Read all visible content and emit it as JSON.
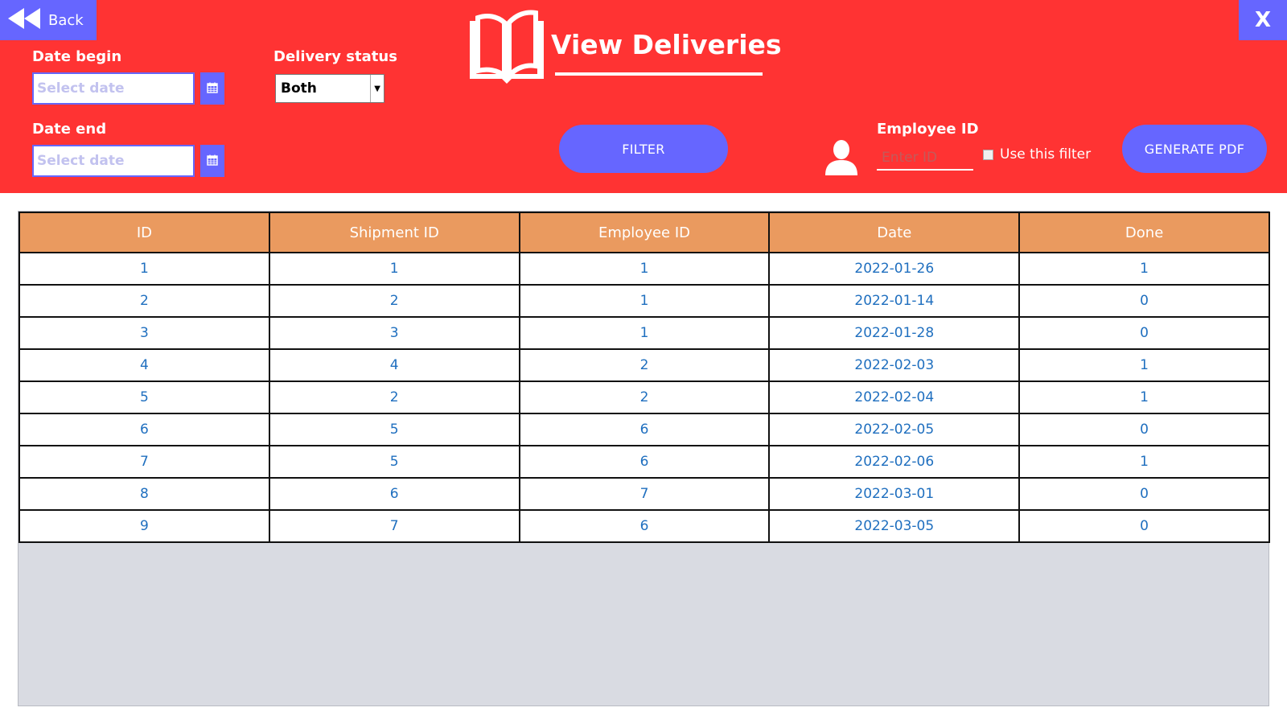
{
  "header": {
    "back_label": "Back",
    "close_label": "X",
    "title": "View Deliveries",
    "bg_color": "#ff3333",
    "accent_color": "#6666ff"
  },
  "filters": {
    "date_begin_label": "Date begin",
    "date_begin_placeholder": "Select date",
    "date_end_label": "Date end",
    "date_end_placeholder": "Select date",
    "delivery_status_label": "Delivery status",
    "delivery_status_value": "Both",
    "filter_button": "FILTER",
    "employee_id_label": "Employee ID",
    "employee_id_placeholder": "Enter ID",
    "use_filter_label": "Use this filter",
    "generate_pdf_button": "GENERATE PDF"
  },
  "icons": {
    "back": "double-left-arrow-icon",
    "calendar": "calendar-icon",
    "book": "book-icon",
    "user": "user-icon"
  },
  "table": {
    "header_color": "#ea9a5f",
    "columns": [
      "ID",
      "Shipment ID",
      "Employee ID",
      "Date",
      "Done"
    ],
    "rows": [
      [
        "1",
        "1",
        "1",
        "2022-01-26",
        "1"
      ],
      [
        "2",
        "2",
        "1",
        "2022-01-14",
        "0"
      ],
      [
        "3",
        "3",
        "1",
        "2022-01-28",
        "0"
      ],
      [
        "4",
        "4",
        "2",
        "2022-02-03",
        "1"
      ],
      [
        "5",
        "2",
        "2",
        "2022-02-04",
        "1"
      ],
      [
        "6",
        "5",
        "6",
        "2022-02-05",
        "0"
      ],
      [
        "7",
        "5",
        "6",
        "2022-02-06",
        "1"
      ],
      [
        "8",
        "6",
        "7",
        "2022-03-01",
        "0"
      ],
      [
        "9",
        "7",
        "6",
        "2022-03-05",
        "0"
      ]
    ]
  }
}
